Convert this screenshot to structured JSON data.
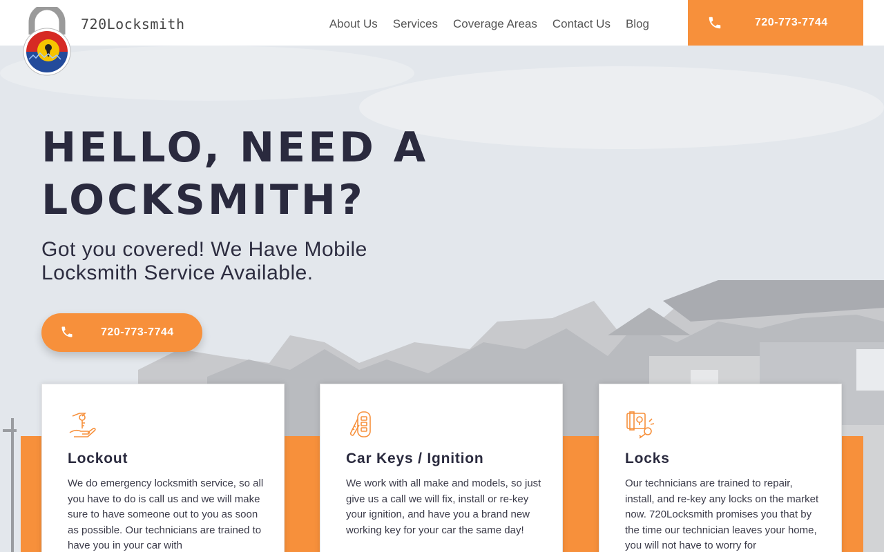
{
  "brand": {
    "name": "720Locksmith"
  },
  "nav": {
    "items": [
      "About Us",
      "Services",
      "Coverage Areas",
      "Contact Us",
      "Blog"
    ]
  },
  "header_cta": {
    "phone": "720-773-7744"
  },
  "hero": {
    "title": "HELLO, NEED A LOCKSMITH?",
    "subtitle": "Got you covered! We Have Mobile Locksmith Service Available.",
    "cta_phone": "720-773-7744"
  },
  "cards": [
    {
      "icon": "key-hand-icon",
      "title": "Lockout",
      "text": "We do emergency locksmith service, so all you have to do is call us and we will make sure to have someone out to you as soon as possible. Our technicians are trained to have you in your car with"
    },
    {
      "icon": "car-key-fob-icon",
      "title": "Car Keys / Ignition",
      "text": "We work with all make and models, so just give us a call we will fix, install or re-key your ignition, and have you a brand new working key for your car the same day!"
    },
    {
      "icon": "door-lock-key-icon",
      "title": "Locks",
      "text": "Our technicians are trained to repair, install, and re-key any locks on the market now. 720Locksmith promises you that by the time our technician leaves your home, you will not have to worry for"
    }
  ],
  "colors": {
    "accent": "#f7903b",
    "heading": "#2a2a3e"
  }
}
